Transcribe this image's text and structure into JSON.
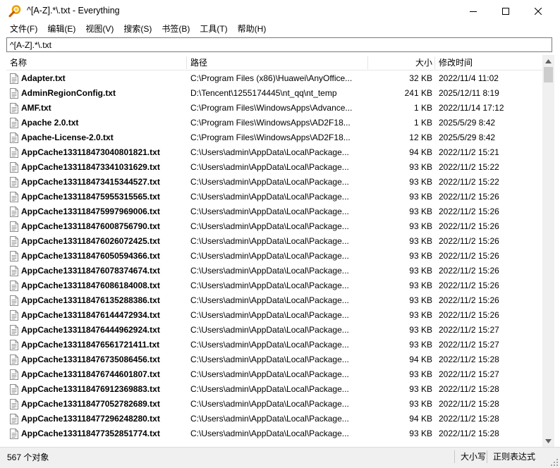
{
  "window": {
    "title": "^[A-Z].*\\.txt - Everything"
  },
  "menu": [
    "文件(F)",
    "编辑(E)",
    "视图(V)",
    "搜索(S)",
    "书签(B)",
    "工具(T)",
    "帮助(H)"
  ],
  "search": {
    "value": "^[A-Z].*\\.txt"
  },
  "columns": {
    "name": "名称",
    "path": "路径",
    "size": "大小",
    "date": "修改时间"
  },
  "rows": [
    {
      "name": "Adapter.txt",
      "path": "C:\\Program Files (x86)\\Huawei\\AnyOffice...",
      "size": "32 KB",
      "date": "2022/11/4 11:02"
    },
    {
      "name": "AdminRegionConfig.txt",
      "path": "D:\\Tencent\\1255174445\\nt_qq\\nt_temp",
      "size": "241 KB",
      "date": "2025/12/11 8:19"
    },
    {
      "name": "AMF.txt",
      "path": "C:\\Program Files\\WindowsApps\\Advance...",
      "size": "1 KB",
      "date": "2022/11/14 17:12"
    },
    {
      "name": "Apache 2.0.txt",
      "path": "C:\\Program Files\\WindowsApps\\AD2F18...",
      "size": "1 KB",
      "date": "2025/5/29 8:42"
    },
    {
      "name": "Apache-License-2.0.txt",
      "path": "C:\\Program Files\\WindowsApps\\AD2F18...",
      "size": "12 KB",
      "date": "2025/5/29 8:42"
    },
    {
      "name": "AppCache133118473040801821.txt",
      "path": "C:\\Users\\admin\\AppData\\Local\\Package...",
      "size": "94 KB",
      "date": "2022/11/2 15:21"
    },
    {
      "name": "AppCache133118473341031629.txt",
      "path": "C:\\Users\\admin\\AppData\\Local\\Package...",
      "size": "93 KB",
      "date": "2022/11/2 15:22"
    },
    {
      "name": "AppCache133118473415344527.txt",
      "path": "C:\\Users\\admin\\AppData\\Local\\Package...",
      "size": "93 KB",
      "date": "2022/11/2 15:22"
    },
    {
      "name": "AppCache133118475955315565.txt",
      "path": "C:\\Users\\admin\\AppData\\Local\\Package...",
      "size": "93 KB",
      "date": "2022/11/2 15:26"
    },
    {
      "name": "AppCache133118475997969006.txt",
      "path": "C:\\Users\\admin\\AppData\\Local\\Package...",
      "size": "93 KB",
      "date": "2022/11/2 15:26"
    },
    {
      "name": "AppCache133118476008756790.txt",
      "path": "C:\\Users\\admin\\AppData\\Local\\Package...",
      "size": "93 KB",
      "date": "2022/11/2 15:26"
    },
    {
      "name": "AppCache133118476026072425.txt",
      "path": "C:\\Users\\admin\\AppData\\Local\\Package...",
      "size": "93 KB",
      "date": "2022/11/2 15:26"
    },
    {
      "name": "AppCache133118476050594366.txt",
      "path": "C:\\Users\\admin\\AppData\\Local\\Package...",
      "size": "93 KB",
      "date": "2022/11/2 15:26"
    },
    {
      "name": "AppCache133118476078374674.txt",
      "path": "C:\\Users\\admin\\AppData\\Local\\Package...",
      "size": "93 KB",
      "date": "2022/11/2 15:26"
    },
    {
      "name": "AppCache133118476086184008.txt",
      "path": "C:\\Users\\admin\\AppData\\Local\\Package...",
      "size": "93 KB",
      "date": "2022/11/2 15:26"
    },
    {
      "name": "AppCache133118476135288386.txt",
      "path": "C:\\Users\\admin\\AppData\\Local\\Package...",
      "size": "93 KB",
      "date": "2022/11/2 15:26"
    },
    {
      "name": "AppCache133118476144472934.txt",
      "path": "C:\\Users\\admin\\AppData\\Local\\Package...",
      "size": "93 KB",
      "date": "2022/11/2 15:26"
    },
    {
      "name": "AppCache133118476444962924.txt",
      "path": "C:\\Users\\admin\\AppData\\Local\\Package...",
      "size": "93 KB",
      "date": "2022/11/2 15:27"
    },
    {
      "name": "AppCache133118476561721411.txt",
      "path": "C:\\Users\\admin\\AppData\\Local\\Package...",
      "size": "93 KB",
      "date": "2022/11/2 15:27"
    },
    {
      "name": "AppCache133118476735086456.txt",
      "path": "C:\\Users\\admin\\AppData\\Local\\Package...",
      "size": "94 KB",
      "date": "2022/11/2 15:28"
    },
    {
      "name": "AppCache133118476744601807.txt",
      "path": "C:\\Users\\admin\\AppData\\Local\\Package...",
      "size": "93 KB",
      "date": "2022/11/2 15:27"
    },
    {
      "name": "AppCache133118476912369883.txt",
      "path": "C:\\Users\\admin\\AppData\\Local\\Package...",
      "size": "93 KB",
      "date": "2022/11/2 15:28"
    },
    {
      "name": "AppCache133118477052782689.txt",
      "path": "C:\\Users\\admin\\AppData\\Local\\Package...",
      "size": "93 KB",
      "date": "2022/11/2 15:28"
    },
    {
      "name": "AppCache133118477296248280.txt",
      "path": "C:\\Users\\admin\\AppData\\Local\\Package...",
      "size": "94 KB",
      "date": "2022/11/2 15:28"
    },
    {
      "name": "AppCache133118477352851774.txt",
      "path": "C:\\Users\\admin\\AppData\\Local\\Package...",
      "size": "93 KB",
      "date": "2022/11/2 15:28"
    }
  ],
  "status": {
    "count": "567 个对象",
    "sort": "大小写",
    "mode": "正则表达式"
  },
  "icons": {
    "app": "magnifier-icon",
    "file": "text-file-icon"
  },
  "colors": {
    "accent": "#e8a000",
    "border": "#7a7a7a",
    "status_bg": "#f0f0f0"
  }
}
